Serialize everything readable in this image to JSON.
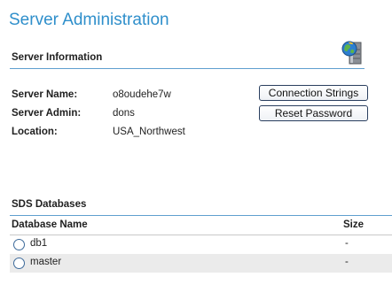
{
  "page": {
    "title": "Server Administration"
  },
  "server_info": {
    "heading": "Server Information",
    "icon": "server-globe-icon",
    "fields": [
      {
        "label": "Server Name:",
        "value": "o8oudehe7w"
      },
      {
        "label": "Server Admin:",
        "value": "dons"
      },
      {
        "label": "Location:",
        "value": "USA_Northwest"
      }
    ],
    "buttons": {
      "connection_strings": "Connection Strings",
      "reset_password": "Reset Password"
    }
  },
  "databases": {
    "heading": "SDS Databases",
    "columns": [
      "Database Name",
      "Size"
    ],
    "rows": [
      {
        "name": "db1",
        "size": "-"
      },
      {
        "name": "master",
        "size": "-"
      }
    ]
  },
  "colors": {
    "title": "#2f8fcb",
    "rule": "#5f9fcf",
    "alt_row": "#ebebeb"
  }
}
